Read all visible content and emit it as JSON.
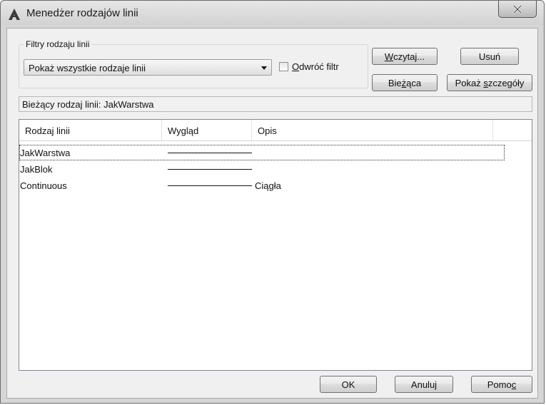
{
  "window": {
    "title": "Menedżer rodzajów linii"
  },
  "filter_group": {
    "legend": "Filtry rodzaju linii",
    "combo_value": "Pokaż wszystkie rodzaje linii",
    "invert_filter_label": "Odwróć filtr"
  },
  "buttons": {
    "load": "Wczytaj...",
    "delete": "Usuń",
    "current": "Bieżąca",
    "show_details": "Pokaż szczegóły",
    "ok": "OK",
    "cancel": "Anuluj",
    "help": "Pomoc"
  },
  "current_linetype": "Bieżący rodzaj linii:  JakWarstwa",
  "list": {
    "columns": [
      "Rodzaj linii",
      "Wygląd",
      "Opis"
    ],
    "rows": [
      {
        "name": "JakWarstwa",
        "description": ""
      },
      {
        "name": "JakBlok",
        "description": ""
      },
      {
        "name": "Continuous",
        "description": "Ciągła"
      }
    ]
  },
  "icons": {
    "app": "autocad-icon",
    "close": "close-icon"
  }
}
